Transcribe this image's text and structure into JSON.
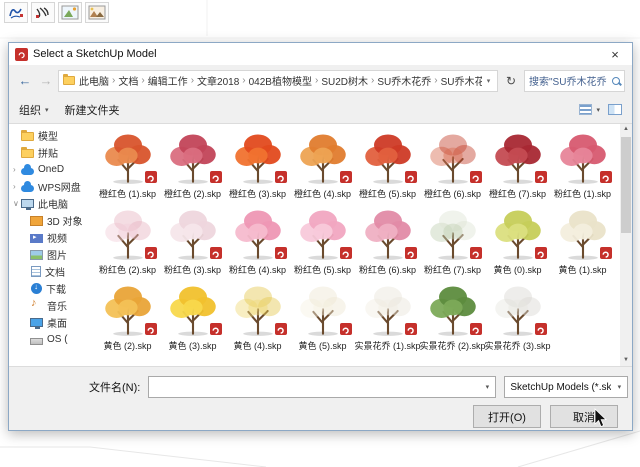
{
  "app": {
    "toolbar_icons": [
      "calligraphy-brush-1-icon",
      "calligraphy-brush-2-icon",
      "scene-thumbnail-1-icon",
      "scene-thumbnail-2-icon"
    ]
  },
  "glyphs": {
    "caret_down": "▾",
    "back": "←",
    "forward": "→",
    "refresh": "↻",
    "close": "×",
    "scroll_up": "▲",
    "scroll_down": "▼"
  },
  "dialog": {
    "title": "Select a SketchUp Model",
    "breadcrumb": [
      "此电脑",
      "文档",
      "编辑工作",
      "文章2018",
      "042B植物模型",
      "SU2D树木",
      "SU乔木花乔",
      "SU乔木花乔"
    ],
    "search_text": "搜索\"SU乔木花乔\"",
    "commands": {
      "organize": "组织",
      "new_folder": "新建文件夹"
    },
    "sidebar": [
      {
        "label": "模型",
        "icon": "folder",
        "chev": "",
        "ind": "lv1"
      },
      {
        "label": "拼贴",
        "icon": "folder",
        "chev": "",
        "ind": "lv1"
      },
      {
        "label": "OneD",
        "icon": "cloud",
        "chev": "›",
        "ind": "lv1"
      },
      {
        "label": "WPS网盘",
        "icon": "cloud",
        "chev": "›",
        "ind": "lv1"
      },
      {
        "label": "此电脑",
        "icon": "pc",
        "chev": "∨",
        "ind": "lv1"
      },
      {
        "label": "3D 对象",
        "icon": "objects",
        "chev": "",
        "ind": "lv2"
      },
      {
        "label": "视频",
        "icon": "video",
        "chev": "",
        "ind": "lv2"
      },
      {
        "label": "图片",
        "icon": "picture",
        "chev": "",
        "ind": "lv2"
      },
      {
        "label": "文档",
        "icon": "docs",
        "chev": "",
        "ind": "lv2"
      },
      {
        "label": "下载",
        "icon": "download",
        "chev": "",
        "ind": "lv2"
      },
      {
        "label": "音乐",
        "icon": "music",
        "chev": "",
        "ind": "lv2"
      },
      {
        "label": "桌面",
        "icon": "desktop",
        "chev": "",
        "ind": "lv2"
      },
      {
        "label": "OS (",
        "icon": "drive",
        "chev": "",
        "ind": "lv2"
      }
    ],
    "files": [
      {
        "name": "橙红色 (1).skp",
        "color": "#d8542c",
        "color2": "#ea8a4e",
        "variant": ""
      },
      {
        "name": "橙红色 (2).skp",
        "color": "#c24458",
        "color2": "#da6e80",
        "variant": ""
      },
      {
        "name": "橙红色 (3).skp",
        "color": "#e14a1e",
        "color2": "#f0722f",
        "variant": ""
      },
      {
        "name": "橙红色 (4).skp",
        "color": "#e07c2e",
        "color2": "#eda353",
        "variant": ""
      },
      {
        "name": "橙红色 (5).skp",
        "color": "#ce3a26",
        "color2": "#e2603e",
        "variant": ""
      },
      {
        "name": "橙红色 (6).skp",
        "color": "#c4402c",
        "color2": "#d86a50",
        "variant": "v-sparse"
      },
      {
        "name": "橙红色 (7).skp",
        "color": "#a82833",
        "color2": "#c44b52",
        "variant": ""
      },
      {
        "name": "粉红色 (1).skp",
        "color": "#d75a70",
        "color2": "#e78599",
        "variant": ""
      },
      {
        "name": "粉红色 (2).skp",
        "color": "#e6b4c2",
        "color2": "#f1cfd9",
        "variant": "v-sparse"
      },
      {
        "name": "粉红色 (3).skp",
        "color": "#eed6dd",
        "color2": "#f6e6ea",
        "variant": ""
      },
      {
        "name": "粉红色 (4).skp",
        "color": "#ee97b4",
        "color2": "#f6bbce",
        "variant": ""
      },
      {
        "name": "粉红色 (5).skp",
        "color": "#f1a7c1",
        "color2": "#f8c9da",
        "variant": ""
      },
      {
        "name": "粉红色 (6).skp",
        "color": "#e28ba6",
        "color2": "#efb0c3",
        "variant": ""
      },
      {
        "name": "粉红色 (7).skp",
        "color": "#dde5d4",
        "color2": "#c2d0b4",
        "variant": "v-sparse"
      },
      {
        "name": "黄色 (0).skp",
        "color": "#c6cd5a",
        "color2": "#dbdf80",
        "variant": ""
      },
      {
        "name": "黄色 (1).skp",
        "color": "#eae3c9",
        "color2": "#f3eedd",
        "variant": ""
      },
      {
        "name": "黄色 (2).skp",
        "color": "#e9a438",
        "color2": "#f3c156",
        "variant": ""
      },
      {
        "name": "黄色 (3).skp",
        "color": "#f1c12d",
        "color2": "#f8d84c",
        "variant": ""
      },
      {
        "name": "黄色 (4).skp",
        "color": "#e4c74f",
        "color2": "#efd978",
        "variant": "v-sparse"
      },
      {
        "name": "黄色 (5).skp",
        "color": "#ede6d3",
        "color2": "#f6f1e3",
        "variant": "v-sparse"
      },
      {
        "name": "实景花乔 (1).skp",
        "color": "#e9e4da",
        "color2": "#f2ede3",
        "variant": "v-sparse"
      },
      {
        "name": "实景花乔 (2).skp",
        "color": "#5d8c3e",
        "color2": "#7caa58",
        "variant": ""
      },
      {
        "name": "实景花乔 (3).skp",
        "color": "#d9d8d2",
        "color2": "#e7e6e0",
        "variant": "v-sparse"
      }
    ],
    "footer": {
      "filename_label": "文件名(N):",
      "filename_value": "",
      "filetype": "SketchUp Models (*.skp)",
      "open": "打开(O)",
      "cancel": "取消"
    }
  }
}
